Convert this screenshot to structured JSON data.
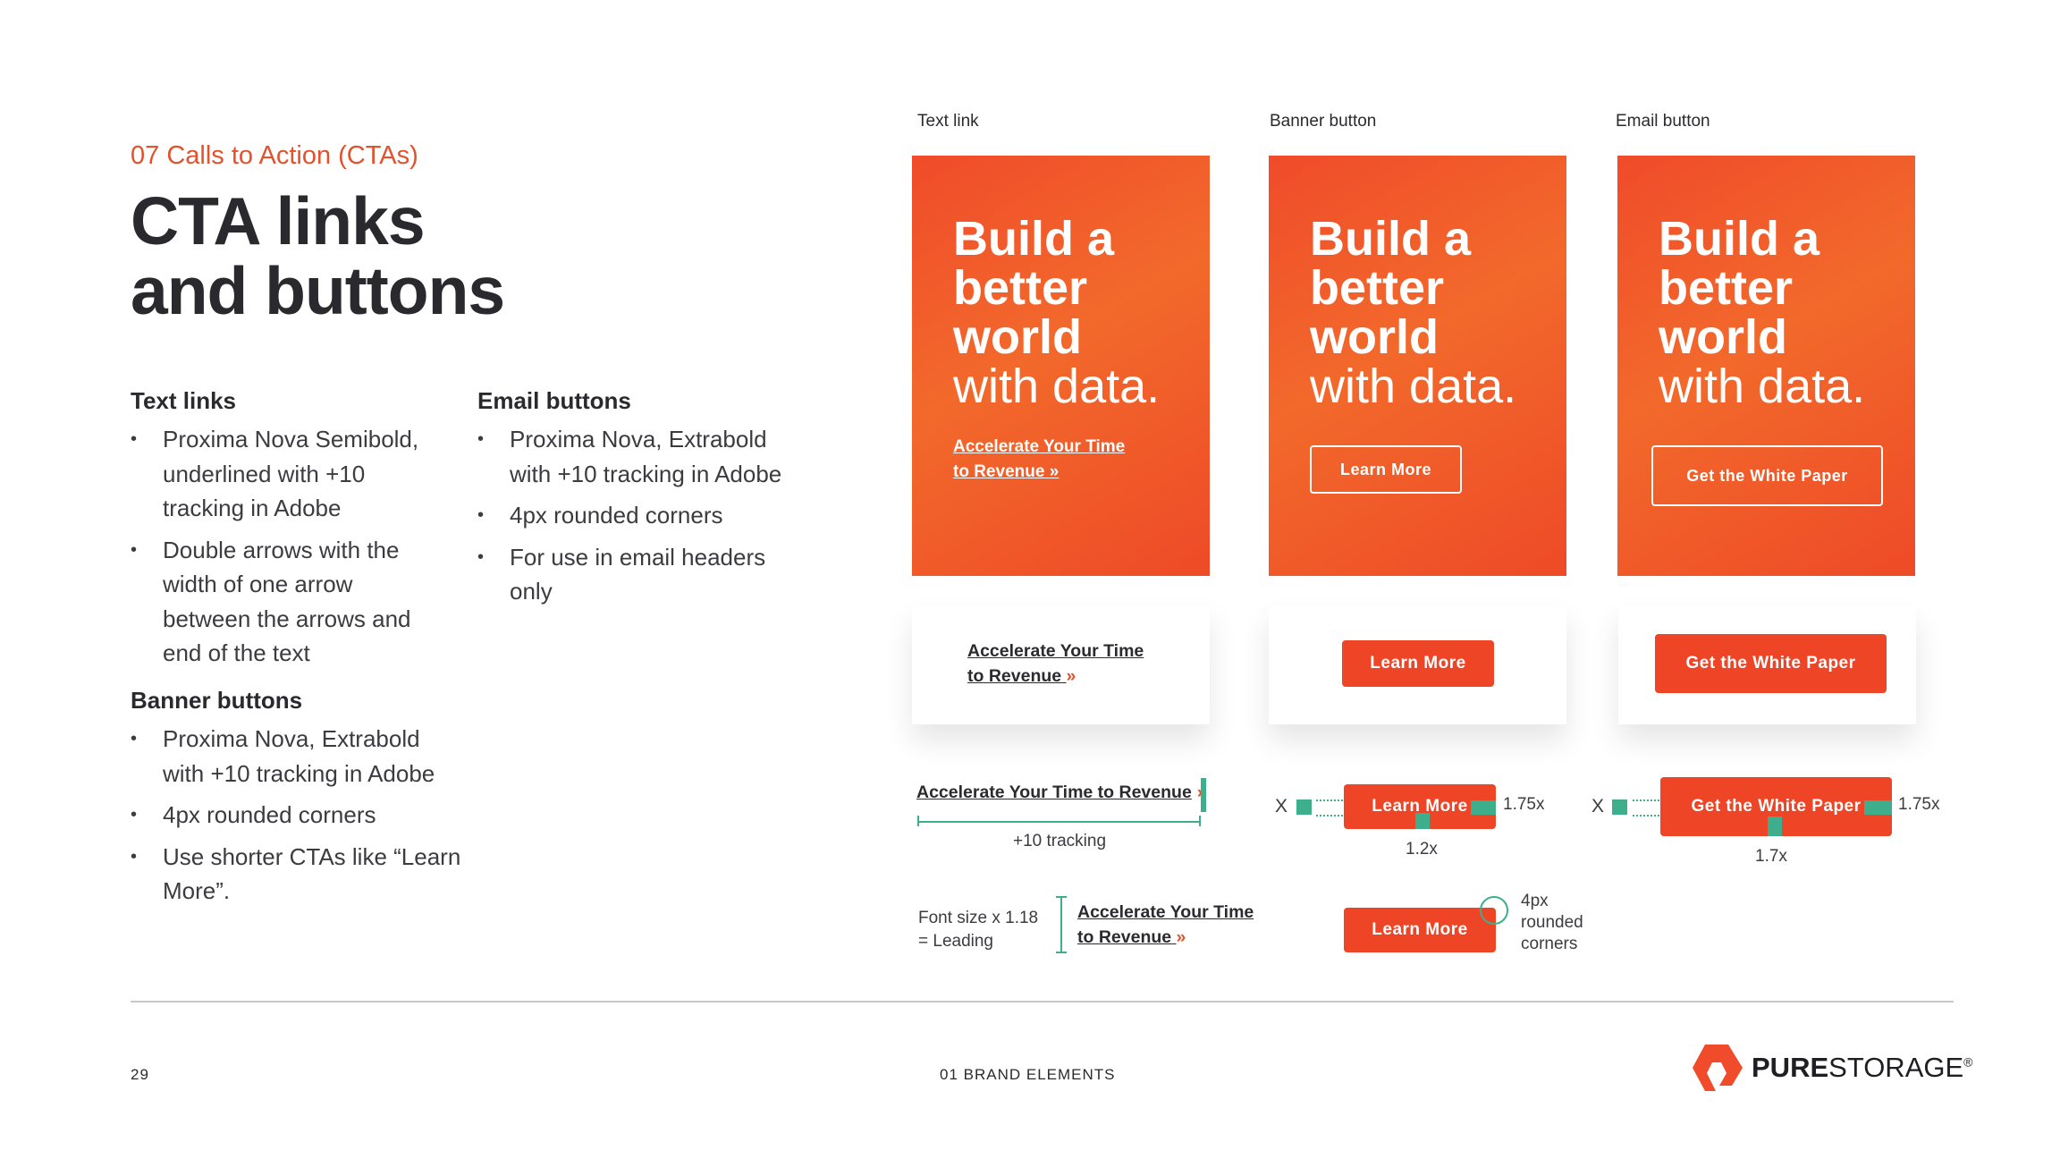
{
  "section_label": "07 Calls to Action (CTAs)",
  "title_line1": "CTA links",
  "title_line2": "and buttons",
  "text_links": {
    "heading": "Text links",
    "items": [
      "Proxima Nova Semibold, underlined with +10 tracking in Adobe",
      "Double arrows with the width of one arrow between the arrows and end of the text"
    ]
  },
  "banner_buttons": {
    "heading": "Banner buttons",
    "items": [
      "Proxima Nova, Extrabold with +10 tracking in Adobe",
      "4px rounded corners",
      "Use shorter CTAs like “Learn More”."
    ]
  },
  "email_buttons": {
    "heading": "Email buttons",
    "items": [
      "Proxima Nova, Extrabold with +10 tracking in Adobe",
      "4px rounded corners",
      "For use in email headers only"
    ]
  },
  "columns": {
    "text_link_label": "Text link",
    "banner_label": "Banner button",
    "email_label": "Email button"
  },
  "card": {
    "line1": "Build a",
    "line2": "better",
    "line3": "world",
    "line4": "with data."
  },
  "cta": {
    "link_line1": "Accelerate Your Time",
    "link_line2": "to Revenue",
    "link_full": "Accelerate Your Time to Revenue",
    "arrows": "»",
    "learn_more": "Learn More",
    "white_paper": "Get the White Paper"
  },
  "annotations": {
    "tracking": "+10 tracking",
    "x": "X",
    "ratio_175": "1.75x",
    "ratio_12": "1.2x",
    "ratio_17": "1.7x",
    "leading_line1": "Font size x 1.18",
    "leading_line2": "= Leading",
    "rounded_line1": "4px",
    "rounded_line2": "rounded",
    "rounded_line3": "corners"
  },
  "footer": {
    "page_number": "29",
    "chapter": "01 BRAND ELEMENTS",
    "logo_bold": "PURE",
    "logo_light": "STORAGE",
    "logo_mark": "®"
  },
  "colors": {
    "accent": "#ee4527",
    "teal": "#3fae8d",
    "text": "#2b2a2e"
  }
}
